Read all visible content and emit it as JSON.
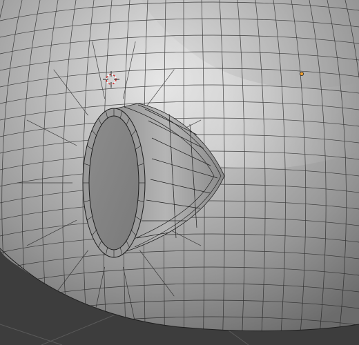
{
  "viewport": {
    "mode": "3d-modeling-viewport",
    "view": "perspective",
    "shading": "solid",
    "overlays": {
      "wireframe": true,
      "grid_floor": true
    }
  },
  "scene": {
    "mesh": "smooth-fuselage-body",
    "feature": "cylindrical-intake-nozzle",
    "cursor": "3d-cursor",
    "origin": "object-origin-dot"
  },
  "colors": {
    "background": "#3d3d3d",
    "mesh_light": "#dedede",
    "mesh_mid": "#a6a6a6",
    "mesh_dark": "#6c6c6c",
    "wire": "#1e1e1e",
    "cursor_red": "#cc2f2f",
    "cursor_white": "#ffffff",
    "origin": "#f0a030",
    "grid_line": "#5a5a5a"
  }
}
